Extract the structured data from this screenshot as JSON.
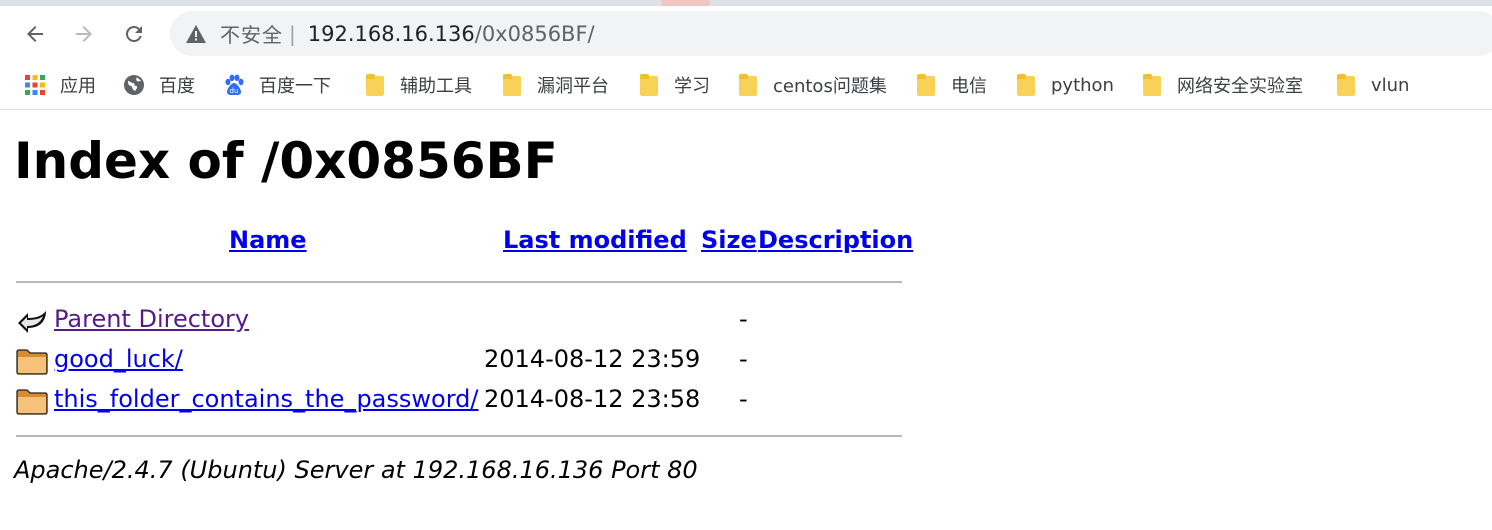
{
  "browser": {
    "security_label": "不安全",
    "separator": "|",
    "url_host": "192.168.16.136",
    "url_path": "/0x0856BF/"
  },
  "bookmarks": [
    {
      "label": "应用",
      "icon": "apps-grid-icon"
    },
    {
      "label": "百度",
      "icon": "globe-icon"
    },
    {
      "label": "百度一下",
      "icon": "baidu-paw-icon"
    },
    {
      "label": "辅助工具",
      "icon": "folder-icon"
    },
    {
      "label": "漏洞平台",
      "icon": "folder-icon"
    },
    {
      "label": "学习",
      "icon": "folder-icon"
    },
    {
      "label": "centos问题集",
      "icon": "folder-icon"
    },
    {
      "label": "电信",
      "icon": "folder-icon"
    },
    {
      "label": "python",
      "icon": "folder-icon"
    },
    {
      "label": "网络安全实验室",
      "icon": "folder-icon"
    },
    {
      "label": "vlun",
      "icon": "folder-icon"
    }
  ],
  "page": {
    "title": "Index of /0x0856BF",
    "columns": {
      "name": "Name",
      "last_modified": "Last modified",
      "size": "Size",
      "description": "Description"
    },
    "rows": [
      {
        "name": "Parent Directory",
        "date": "",
        "size": "-",
        "icon": "back-arrow-icon"
      },
      {
        "name": "good_luck/",
        "date": "2014-08-12 23:59",
        "size": "-",
        "icon": "folder-icon"
      },
      {
        "name": "this_folder_contains_the_password/",
        "date": "2014-08-12 23:58",
        "size": "-",
        "icon": "folder-icon"
      }
    ],
    "footer": "Apache/2.4.7 (Ubuntu) Server at 192.168.16.136 Port 80"
  },
  "colors": {
    "link": "#0000ee",
    "visited_link": "#551a8b",
    "folder": "#f8d257",
    "omnibox_bg": "#f1f3f4"
  }
}
